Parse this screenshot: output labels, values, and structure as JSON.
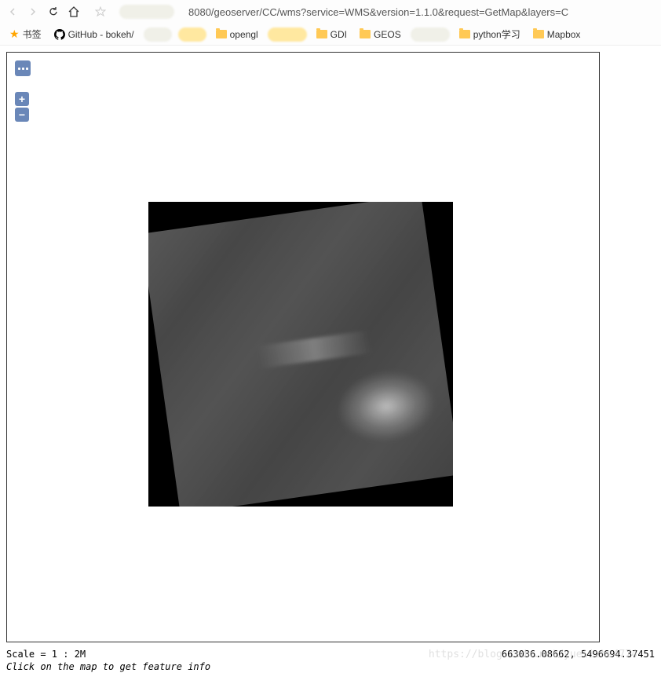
{
  "browser": {
    "url": "8080/geoserver/CC/wms?service=WMS&version=1.1.0&request=GetMap&layers=C"
  },
  "bookmarks": {
    "label": "书签",
    "items": [
      {
        "label": "GitHub - bokeh/",
        "type": "github"
      },
      {
        "label": "opengl",
        "type": "folder"
      },
      {
        "label": "GDI",
        "type": "folder"
      },
      {
        "label": "GEOS",
        "type": "folder"
      },
      {
        "label": "python学习",
        "type": "folder"
      },
      {
        "label": "Mapbox",
        "type": "folder"
      }
    ]
  },
  "map": {
    "zoom_in": "+",
    "zoom_out": "−",
    "scale": "Scale = 1 : 2M",
    "coordinates": "663036.08662, 5496694.37451",
    "hint": "Click on the map to get feature info"
  },
  "watermark": "https://blog.csdn.net/yuelizhe4774"
}
